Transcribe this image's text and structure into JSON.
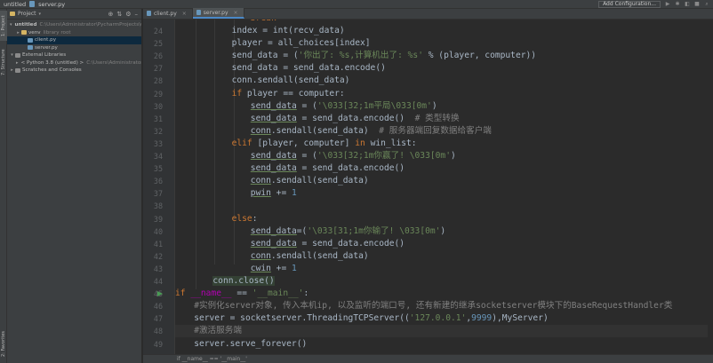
{
  "titlebar": {
    "project": "untitled",
    "file": "server.py",
    "run_config": "Add Configuration..."
  },
  "left_strip": {
    "project_tab": "1: Project",
    "structure_tab": "7: Structure",
    "favorites_tab": "2: Favorites"
  },
  "project_panel": {
    "title": "Project",
    "tree": [
      {
        "label": "untitled",
        "path": "C:\\Users\\Administrator\\PycharmProjects\\untitled",
        "kind": "folder",
        "level": 0,
        "expanded": true,
        "selected": false,
        "bold": true
      },
      {
        "label": "venv",
        "path": "library root",
        "kind": "folder",
        "level": 1,
        "expanded": false,
        "selected": false
      },
      {
        "label": "client.py",
        "path": "",
        "kind": "py",
        "level": 2,
        "selected": true
      },
      {
        "label": "server.py",
        "path": "",
        "kind": "py",
        "level": 2,
        "selected": false
      },
      {
        "label": "External Libraries",
        "path": "",
        "kind": "lib",
        "level": 0,
        "expanded": true,
        "selected": false
      },
      {
        "label": "< Python 3.8 (untitled) >",
        "path": "C:\\Users\\Administrator\\PycharmProjects\\untitled\\venv",
        "kind": "lib",
        "level": 1,
        "expanded": false,
        "selected": false
      },
      {
        "label": "Scratches and Consoles",
        "path": "",
        "kind": "lib",
        "level": 0,
        "expanded": false,
        "selected": false
      }
    ]
  },
  "tabs": [
    {
      "label": "client.py",
      "active": false
    },
    {
      "label": "server.py",
      "active": true
    }
  ],
  "editor": {
    "partial_top_line": "break",
    "current_line": 48,
    "run_gutter_line": 45,
    "lines": [
      {
        "n": "24",
        "indent": 3,
        "segs": [
          [
            "index = ",
            ""
          ],
          [
            "int",
            ""
          ],
          [
            "(recv_data)",
            ""
          ]
        ]
      },
      {
        "n": "25",
        "indent": 3,
        "segs": [
          [
            "player = all_choices[index]",
            ""
          ]
        ]
      },
      {
        "n": "26",
        "indent": 3,
        "segs": [
          [
            "send_data = (",
            ""
          ],
          [
            "'你出了: %s,计算机出了: %s'",
            "st"
          ],
          [
            " % (player, computer))",
            ""
          ]
        ]
      },
      {
        "n": "27",
        "indent": 3,
        "segs": [
          [
            "send_data = send_data.encode()",
            ""
          ]
        ]
      },
      {
        "n": "28",
        "indent": 3,
        "segs": [
          [
            "conn.sendall(send_data)",
            ""
          ]
        ]
      },
      {
        "n": "29",
        "indent": 3,
        "segs": [
          [
            "if",
            "kw"
          ],
          [
            " player == computer:",
            ""
          ]
        ]
      },
      {
        "n": "30",
        "indent": 4,
        "segs": [
          [
            "send_data",
            "us"
          ],
          [
            " = (",
            ""
          ],
          [
            "'\\033[32;1m平局\\033[0m'",
            "st"
          ],
          [
            ")",
            ""
          ]
        ]
      },
      {
        "n": "31",
        "indent": 4,
        "segs": [
          [
            "send_data",
            "us"
          ],
          [
            " = send_data.encode()",
            ""
          ],
          [
            "  # 类型转换",
            "cm"
          ]
        ]
      },
      {
        "n": "32",
        "indent": 4,
        "segs": [
          [
            "conn",
            "us"
          ],
          [
            ".sendall(send_data)",
            ""
          ],
          [
            "  # 服务器端回复数据给客户端",
            "cm"
          ]
        ]
      },
      {
        "n": "33",
        "indent": 3,
        "segs": [
          [
            "elif",
            "kw"
          ],
          [
            " [player, computer] ",
            ""
          ],
          [
            "in",
            "kw"
          ],
          [
            " win_list:",
            ""
          ]
        ]
      },
      {
        "n": "34",
        "indent": 4,
        "segs": [
          [
            "send_data",
            "us"
          ],
          [
            " = (",
            ""
          ],
          [
            "'\\033[32;1m你赢了! \\033[0m'",
            "st"
          ],
          [
            ")",
            ""
          ]
        ]
      },
      {
        "n": "35",
        "indent": 4,
        "segs": [
          [
            "send_data",
            "us"
          ],
          [
            " = send_data.encode()",
            ""
          ]
        ]
      },
      {
        "n": "36",
        "indent": 4,
        "segs": [
          [
            "conn",
            "us"
          ],
          [
            ".sendall(send_data)",
            ""
          ]
        ]
      },
      {
        "n": "37",
        "indent": 4,
        "segs": [
          [
            "pwin",
            "us"
          ],
          [
            " += ",
            ""
          ],
          [
            "1",
            "nm"
          ]
        ]
      },
      {
        "n": "38",
        "indent": 0,
        "segs": []
      },
      {
        "n": "39",
        "indent": 3,
        "segs": [
          [
            "else",
            "kw"
          ],
          [
            ":",
            ""
          ]
        ]
      },
      {
        "n": "40",
        "indent": 4,
        "segs": [
          [
            "send_data",
            "us"
          ],
          [
            "=(",
            ""
          ],
          [
            "'\\033[31;1m你输了! \\033[0m'",
            "st"
          ],
          [
            ")",
            ""
          ]
        ]
      },
      {
        "n": "41",
        "indent": 4,
        "segs": [
          [
            "send_data",
            "us"
          ],
          [
            " = send_data.encode()",
            ""
          ]
        ]
      },
      {
        "n": "42",
        "indent": 4,
        "segs": [
          [
            "conn",
            "us"
          ],
          [
            ".sendall(send_data)",
            ""
          ]
        ]
      },
      {
        "n": "43",
        "indent": 4,
        "segs": [
          [
            "cwin",
            "us"
          ],
          [
            " += ",
            ""
          ],
          [
            "1",
            "nm"
          ]
        ]
      },
      {
        "n": "44",
        "indent": 2,
        "segs": [
          [
            "conn.close()",
            "hl"
          ]
        ]
      },
      {
        "n": "45",
        "indent": 0,
        "segs": [
          [
            "if",
            "kw"
          ],
          [
            " ",
            ""
          ],
          [
            "__name__",
            "dn"
          ],
          [
            " == ",
            ""
          ],
          [
            "'__main__'",
            "st"
          ],
          [
            ":",
            ""
          ]
        ]
      },
      {
        "n": "46",
        "indent": 1,
        "segs": [
          [
            "#实例化server对象, 传入本机ip, 以及监听的端口号, 还有新建的继承socketserver模块下的BaseRequestHandler类",
            "cm"
          ]
        ]
      },
      {
        "n": "47",
        "indent": 1,
        "segs": [
          [
            "server = socketserver.ThreadingTCPServer((",
            ""
          ],
          [
            "'127.0.0.1'",
            "st"
          ],
          [
            ",",
            ""
          ],
          [
            "9999",
            "nm"
          ],
          [
            "),MyServer)",
            ""
          ]
        ]
      },
      {
        "n": "48",
        "indent": 1,
        "segs": [
          [
            "#激活服务端",
            "cm"
          ]
        ]
      },
      {
        "n": "49",
        "indent": 1,
        "segs": [
          [
            "server.serve_forever()",
            ""
          ]
        ]
      }
    ]
  },
  "status": {
    "crumb_1": "if __name__ == '__main__'"
  },
  "colors": {
    "editor_bg": "#2b2b2b",
    "keyword": "#cc7832",
    "string": "#6a8759",
    "comment": "#808080",
    "number": "#6897bb",
    "dunder": "#b200b2",
    "selection": "#0d293e"
  }
}
